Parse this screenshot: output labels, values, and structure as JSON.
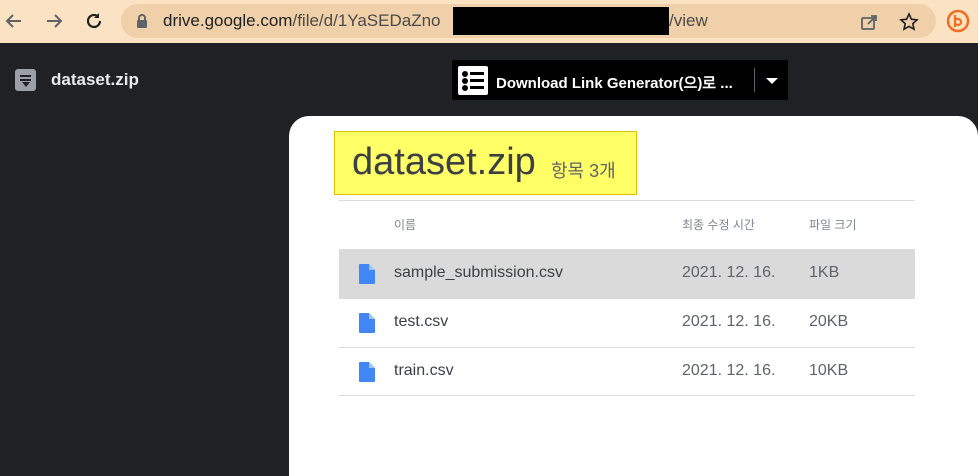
{
  "browser": {
    "url_host": "drive.google.com",
    "url_path_visible": "/file/d/1YaSEDaZno",
    "url_suffix": "/view",
    "icons": [
      "back-arrow-icon",
      "forward-arrow-icon",
      "reload-icon",
      "lock-icon",
      "share-icon",
      "star-icon",
      "extension-icon"
    ]
  },
  "header": {
    "file_title": "dataset.zip",
    "open_with_label": "Download Link Generator(으)로 ..."
  },
  "card": {
    "title": "dataset.zip",
    "item_count": "항목 3개"
  },
  "table": {
    "columns": {
      "name": "이름",
      "modified": "최종 수정 시간",
      "size": "파일 크기"
    },
    "rows": [
      {
        "name": "sample_submission.csv",
        "modified": "2021. 12. 16.",
        "size": "1KB",
        "selected": true
      },
      {
        "name": "test.csv",
        "modified": "2021. 12. 16.",
        "size": "20KB",
        "selected": false
      },
      {
        "name": "train.csv",
        "modified": "2021. 12. 16.",
        "size": "10KB",
        "selected": false
      }
    ]
  },
  "colors": {
    "toolbar_bg": "#fbe2c2",
    "page_bg": "#202124",
    "highlight": "#ffff66",
    "doc_icon_blue": "#4285f4"
  }
}
